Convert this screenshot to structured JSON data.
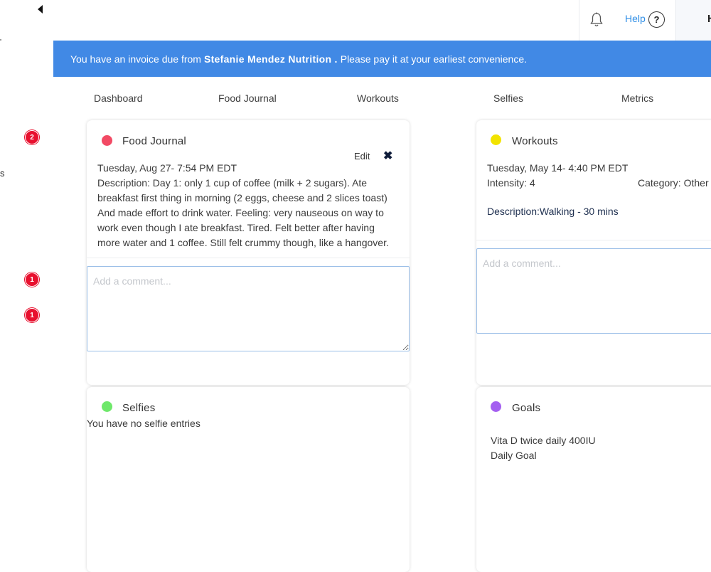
{
  "sidebar": {
    "label_fragment": "s",
    "badges": [
      "2",
      "1",
      "1"
    ]
  },
  "header": {
    "help_label": "Help",
    "help_icon": "?",
    "right_fragment": "H"
  },
  "banner": {
    "prefix": "You have an invoice due from ",
    "sender": "Stefanie Mendez Nutrition .",
    "suffix": " Please pay it at your earliest convenience."
  },
  "tabs": [
    "Dashboard",
    "Food Journal",
    "Workouts",
    "Selfies",
    "Metrics"
  ],
  "food_journal": {
    "title": "Food Journal",
    "dot_color": "#f24a64",
    "edit_label": "Edit",
    "close_icon": "✖",
    "date": "Tuesday, Aug 27- 7:54 PM EDT",
    "description": "Description: Day 1: only 1 cup of coffee (milk + 2 sugars). Ate breakfast first thing in morning (2 eggs, cheese and 2 slices toast) And made effort to drink water. Feeling: very nauseous on way to work even though I ate breakfast. Tired. Felt better after having more water and 1 coffee. Still felt crummy though, like a hangover.",
    "comment_placeholder": "Add a comment..."
  },
  "workouts": {
    "title": "Workouts",
    "dot_color": "#f2e300",
    "date": "Tuesday, May 14- 4:40 PM EDT",
    "intensity": "Intensity: 4",
    "category": "Category: Other",
    "description_label": "Description:",
    "description_value": "Walking - 30 mins",
    "comment_placeholder": "Add a comment..."
  },
  "selfies": {
    "title": "Selfies",
    "dot_color": "#6ee86a",
    "empty_text": "You have no selfie entries"
  },
  "goals": {
    "title": "Goals",
    "dot_color": "#a45ff0",
    "goal_text": "Vita D twice daily 400IU",
    "goal_frequency": "Daily Goal"
  },
  "colors": {
    "banner_bg": "#4189e5",
    "badge_bg": "#e8102e",
    "link": "#2f8ee6"
  }
}
